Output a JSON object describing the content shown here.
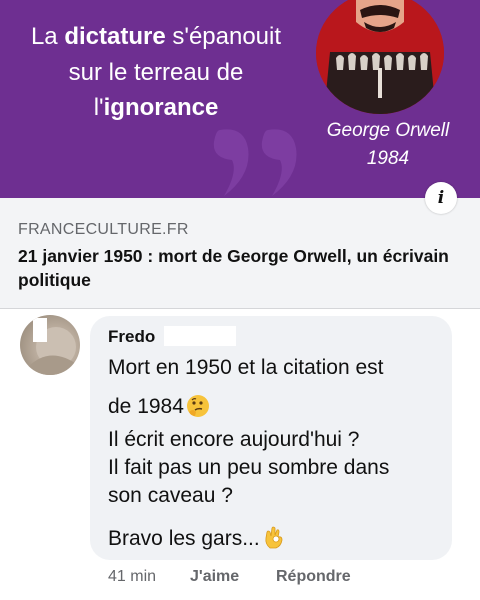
{
  "post": {
    "quote_pre": "La ",
    "quote_bold1": "dictature",
    "quote_post1": " s'épanouit",
    "quote_line2": "sur le terreau de",
    "quote_pre3": "l'",
    "quote_bold3": "ignorance",
    "author": "George Orwell",
    "year": "1984",
    "info_icon": "i"
  },
  "link": {
    "domain": "FRANCECULTURE.FR",
    "title": "21 janvier 1950 : mort de George Orwell, un écrivain politique"
  },
  "comment": {
    "author": "Fredo",
    "line1": "Mort en 1950 et la citation est",
    "line2": "de 1984",
    "line3": "Il écrit encore aujourd'hui ?",
    "line4": "Il fait pas un peu sombre dans",
    "line5": "son caveau ?",
    "line6": "Bravo les gars...",
    "emoji1": "thinking-face-emoji",
    "emoji2": "ok-hand-emoji",
    "time": "41 min",
    "like_label": "J'aime",
    "reply_label": "Répondre"
  },
  "colors": {
    "banner": "#6e2f91",
    "portrait": "#b9171c",
    "bubble": "#f0f2f5",
    "link_card": "#f3f4f6",
    "meta_text": "#65676b"
  }
}
